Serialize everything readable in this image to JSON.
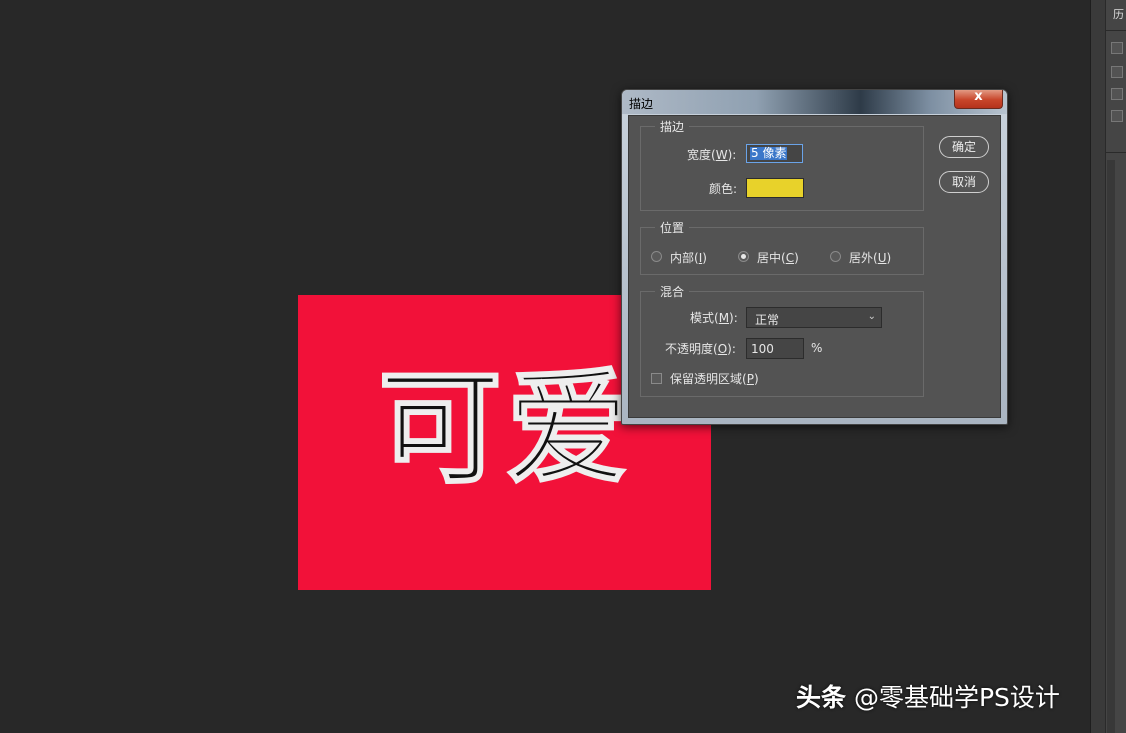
{
  "canvas": {
    "text": "可爱",
    "background": "#f21139"
  },
  "dialog": {
    "title": "描边",
    "close_label": "x",
    "stroke_group": {
      "title": "描边",
      "width_label": "宽度(",
      "width_key": "W",
      "width_label_end": "):",
      "width_value": "5 像素",
      "color_label": "颜色:",
      "color_value": "#e8d22a"
    },
    "position_group": {
      "title": "位置",
      "options": [
        {
          "label": "内部(",
          "key": "I",
          "end": ")",
          "checked": false
        },
        {
          "label": "居中(",
          "key": "C",
          "end": ")",
          "checked": true
        },
        {
          "label": "居外(",
          "key": "U",
          "end": ")",
          "checked": false
        }
      ]
    },
    "blend_group": {
      "title": "混合",
      "mode_label": "模式(",
      "mode_key": "M",
      "mode_label_end": "):",
      "mode_value": "正常",
      "opacity_label": "不透明度(",
      "opacity_key": "O",
      "opacity_label_end": "):",
      "opacity_value": "100",
      "opacity_unit": "%",
      "preserve_label": "保留透明区域(",
      "preserve_key": "P",
      "preserve_label_end": ")",
      "preserve_checked": false
    },
    "ok_label": "确定",
    "cancel_label": "取消"
  },
  "panel": {
    "label": "历"
  },
  "watermark": {
    "brand": "头条",
    "handle": "@零基础学PS设计"
  }
}
